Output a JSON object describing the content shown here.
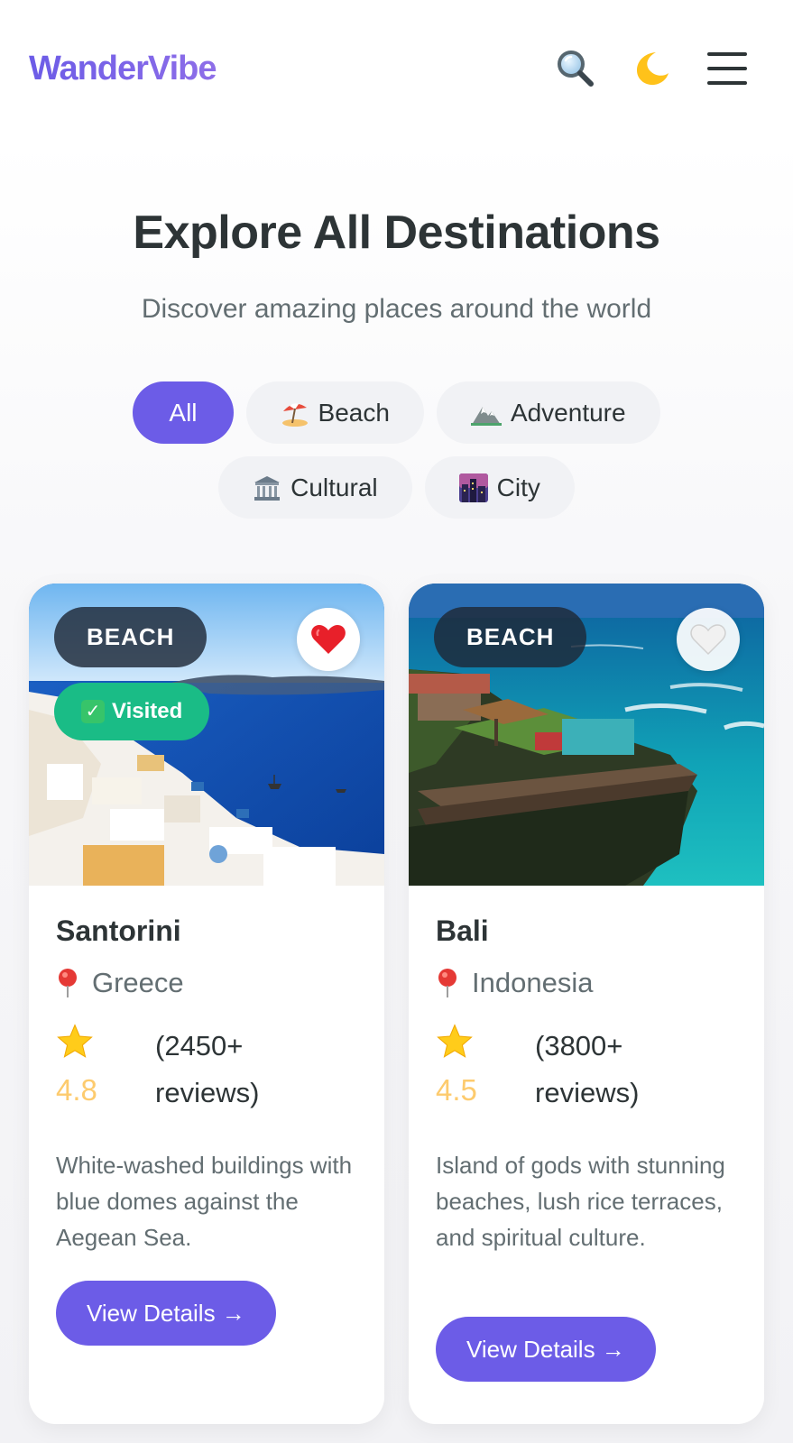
{
  "header": {
    "logo": "WanderVibe",
    "icons": [
      "search-icon",
      "moon-icon",
      "menu-icon"
    ]
  },
  "hero": {
    "title": "Explore All Destinations",
    "subtitle": "Discover amazing places around the world"
  },
  "filters": [
    {
      "label": "All",
      "icon": "",
      "active": true
    },
    {
      "label": "Beach",
      "icon": "beach-umbrella-icon",
      "active": false
    },
    {
      "label": "Adventure",
      "icon": "mountain-icon",
      "active": false
    },
    {
      "label": "Cultural",
      "icon": "museum-icon",
      "active": false
    },
    {
      "label": "City",
      "icon": "cityscape-icon",
      "active": false
    }
  ],
  "cards": [
    {
      "badge": "BEACH",
      "visited": "Visited",
      "favorite": true,
      "name": "Santorini",
      "location": "Greece",
      "rating": "4.8",
      "reviews": "(2450+ reviews)",
      "description": "White-washed buildings with blue domes against the Aegean Sea.",
      "button": "View Details →"
    },
    {
      "badge": "BEACH",
      "favorite": false,
      "name": "Bali",
      "location": "Indonesia",
      "rating": "4.5",
      "reviews": "(3800+ reviews)",
      "description": "Island of gods with stunning beaches, lush rice terraces, and spiritual culture.",
      "button": "View Details →"
    }
  ],
  "colors": {
    "accent": "#6c5ce7",
    "visited": "#1abc86",
    "star": "#fdcb6e",
    "heart": "#e8202a"
  }
}
